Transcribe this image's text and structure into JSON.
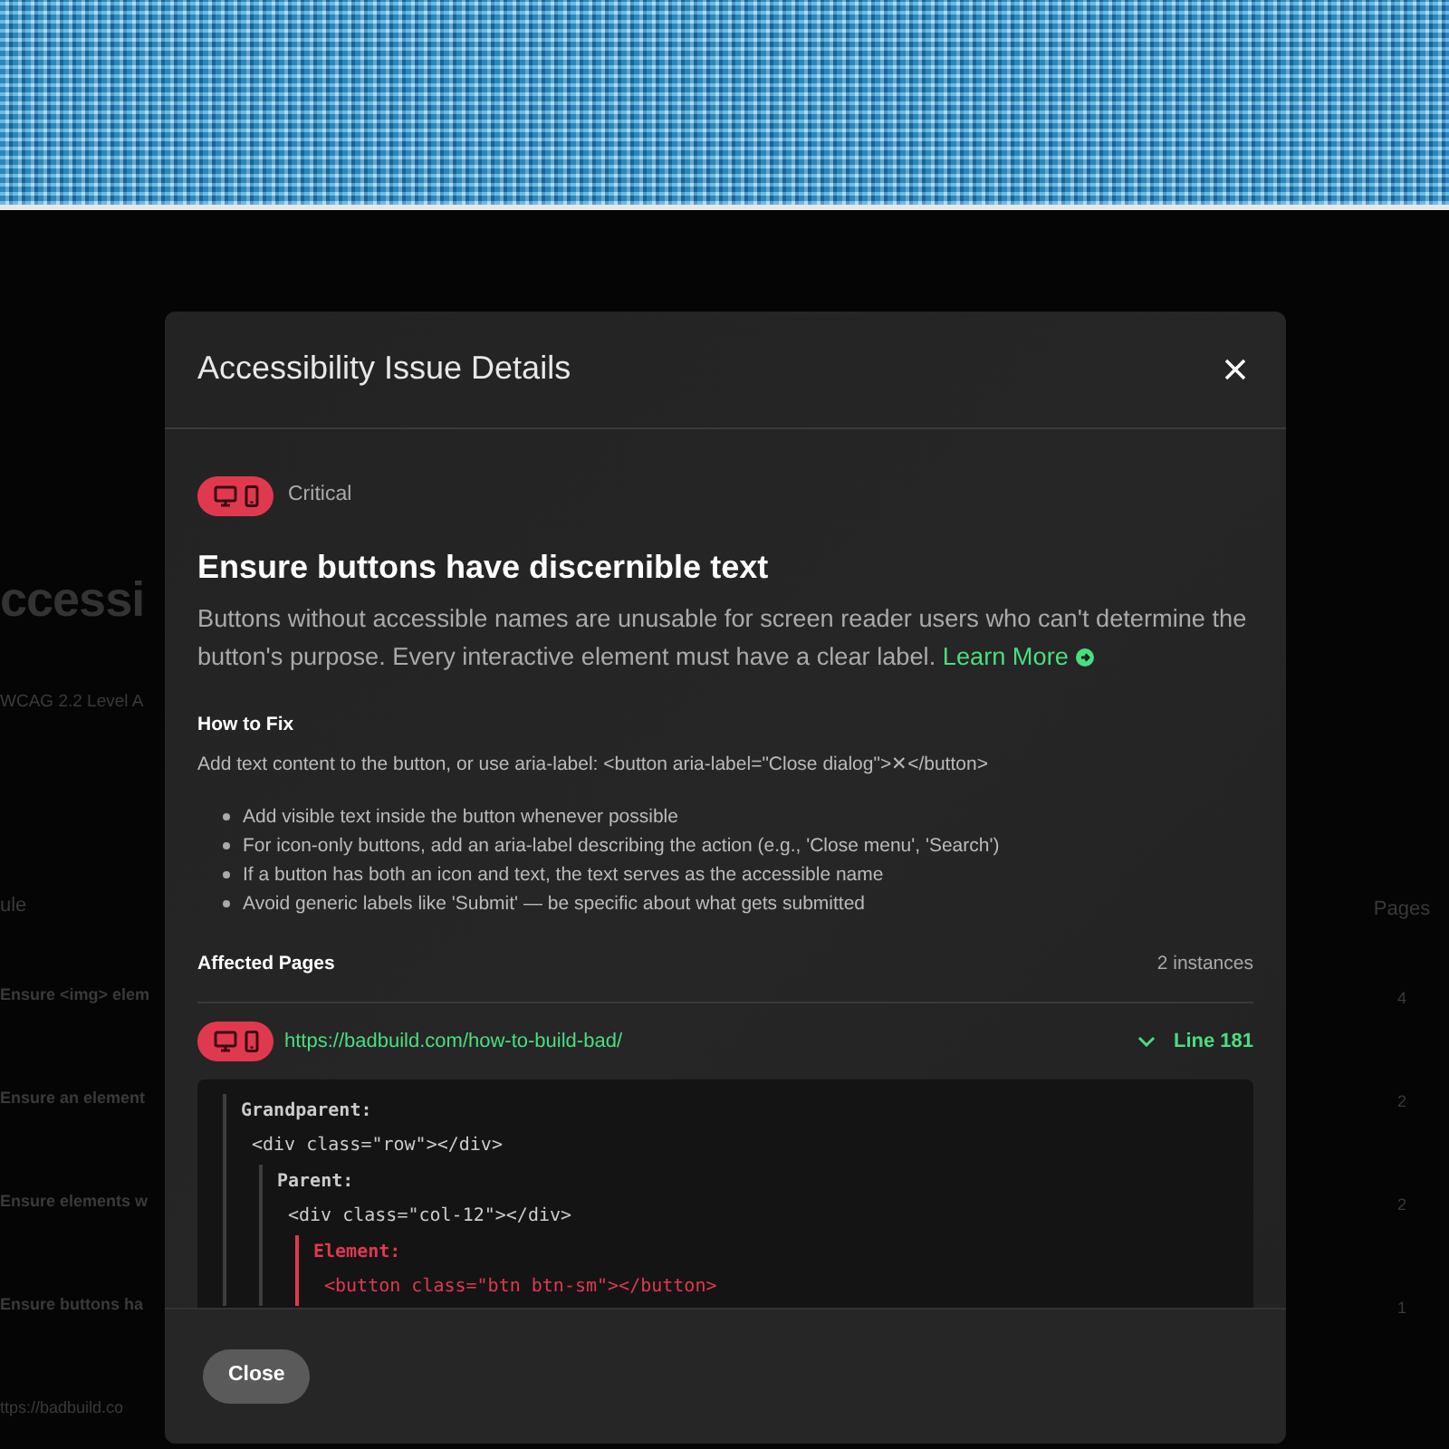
{
  "background_page": {
    "heading": "ccessi",
    "subtitle": "WCAG 2.2 Level A",
    "table": {
      "columns": [
        "ule",
        "Pages"
      ],
      "rows": [
        {
          "rule": "Ensure <img> elem",
          "pages": "4"
        },
        {
          "rule": "Ensure an element",
          "pages": "2"
        },
        {
          "rule": "Ensure elements w",
          "pages": "2"
        },
        {
          "rule": "Ensure buttons ha",
          "pages": "1"
        }
      ]
    },
    "footer_link": "ttps://badbuild.co"
  },
  "dialog": {
    "title": "Accessibility Issue Details",
    "severity": "Critical",
    "heading": "Ensure buttons have discernible text",
    "description": "Buttons without accessible names are unusable for screen reader users who can't determine the button's purpose. Every interactive element must have a clear label.",
    "learn_more": "Learn More",
    "how_to_fix": {
      "title": "How to Fix",
      "text": "Add text content to the button, or use aria-label: <button aria-label=\"Close dialog\">✕</button>",
      "tips": [
        "Add visible text inside the button whenever possible",
        "For icon-only buttons, add an aria-label describing the action (e.g., 'Close menu', 'Search')",
        "If a button has both an icon and text, the text serves as the accessible name",
        "Avoid generic labels like 'Submit' — be specific about what gets submitted"
      ]
    },
    "affected_pages": {
      "title": "Affected Pages",
      "count": "2 instances",
      "items": [
        {
          "url": "https://badbuild.com/how-to-build-bad/",
          "line": "Line 181",
          "expanded": true,
          "context": [
            {
              "kind": "ancestor",
              "label": "Grandparent:",
              "code": "<div class=\"row\"></div>",
              "children": [
                {
                  "kind": "ancestor",
                  "label": "Parent:",
                  "code": "<div class=\"col-12\"></div>",
                  "children": [
                    {
                      "kind": "element",
                      "label": "Element:",
                      "code": "<button class=\"btn btn-sm\"></button>"
                    }
                  ]
                }
              ]
            }
          ]
        }
      ]
    },
    "buttons": [
      {
        "label": "Close"
      }
    ]
  }
}
